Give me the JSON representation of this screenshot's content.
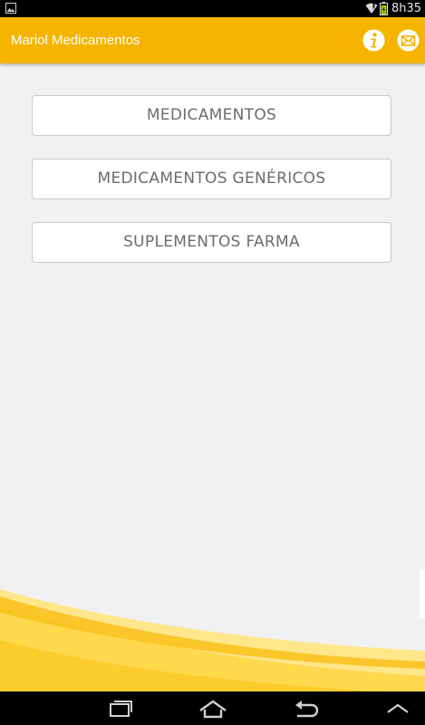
{
  "status_bar": {
    "time": "8h35",
    "icons": [
      "gallery-icon",
      "wifi-icon",
      "battery-icon"
    ]
  },
  "action_bar": {
    "title": "Mariol Medicamentos",
    "actions": [
      {
        "name": "info-icon",
        "color": "#ffffff"
      },
      {
        "name": "mail-icon",
        "color": "#ffffff"
      }
    ]
  },
  "menu": {
    "buttons": [
      {
        "label": "MEDICAMENTOS"
      },
      {
        "label": "MEDICAMENTOS GENÉRICOS"
      },
      {
        "label": "SUPLEMENTOS FARMA"
      }
    ]
  },
  "nav_bar": {
    "icons": [
      "recent-apps-icon",
      "home-icon",
      "back-icon",
      "up-arrow-icon"
    ]
  },
  "theme": {
    "accent": "#f4b400",
    "background": "#f1f1f1",
    "button_text": "#6c6c6c",
    "wave_light": "#ffe27a",
    "wave_dark": "#f7c21a"
  }
}
